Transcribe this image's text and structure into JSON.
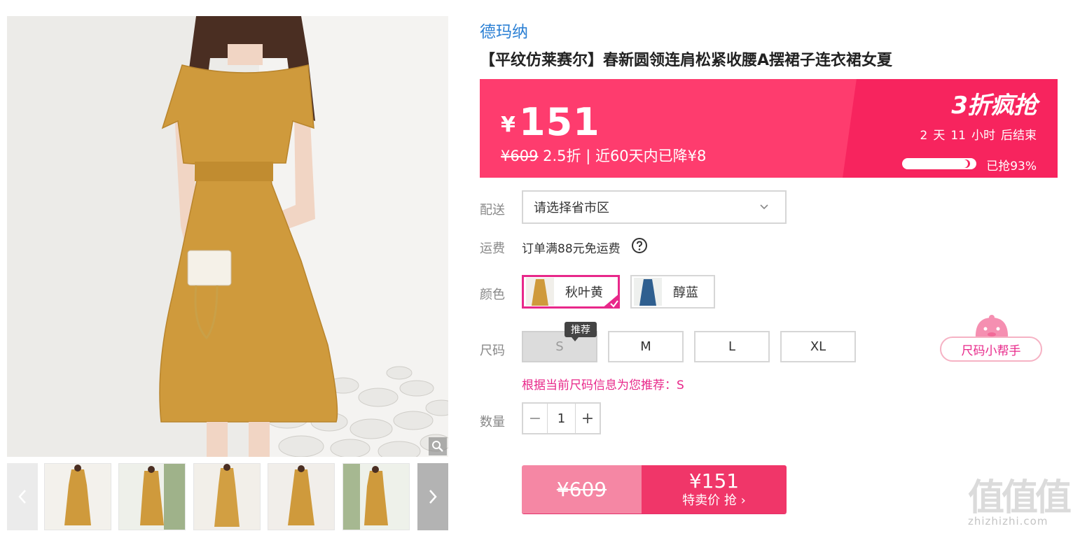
{
  "brand": "德玛纳",
  "product_title": "【平纹仿莱赛尔】春新圆领连肩松紧收腰A摆裙子连衣裙女夏",
  "price": {
    "currency": "¥",
    "current": "151",
    "original": "¥609",
    "sub_info": " 2.5折 | 近60天内已降¥8",
    "promo_title": "3折疯抢",
    "countdown": [
      "2",
      "天",
      "11",
      "小时",
      "后结束"
    ],
    "sold_label": "已抢93%",
    "sold_progress": 0.93
  },
  "delivery": {
    "label": "配送",
    "placeholder": "请选择省市区"
  },
  "freight": {
    "label": "运费",
    "text": "订单满88元免运费"
  },
  "colors": {
    "label": "颜色",
    "options": [
      {
        "name": "秋叶黄",
        "selected": true
      },
      {
        "name": "醇蓝",
        "selected": false
      }
    ]
  },
  "sizes": {
    "label": "尺码",
    "options": [
      "S",
      "M",
      "L",
      "XL"
    ],
    "recommend_tag": "推荐",
    "recommend_text": "根据当前尺码信息为您推荐：S",
    "helper_label": "尺码小帮手"
  },
  "quantity": {
    "label": "数量",
    "value": "1",
    "minus": "−",
    "plus": "+"
  },
  "buy": {
    "original": "¥609",
    "price": "¥151",
    "label": "特卖价 抢 ›"
  },
  "watermark": {
    "glyphs": "值值值",
    "url": "zhizhizhi.com"
  },
  "colors_theme": {
    "accent_pink": "#fe3c6e",
    "brand_blue": "#2a7fd4",
    "select_pink": "#e8288a"
  }
}
